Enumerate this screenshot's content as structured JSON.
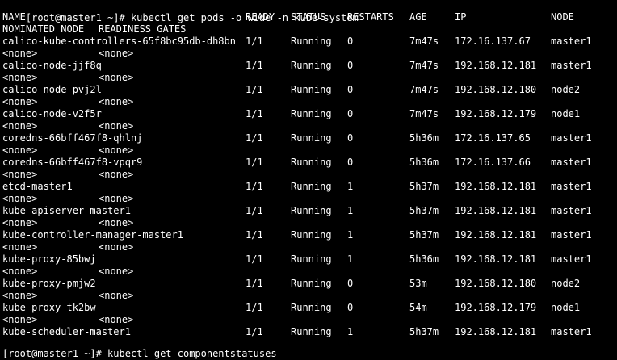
{
  "terminal": {
    "prompt": "[root@master1 ~]# ",
    "command": "kubectl get pods -o wide -n kube-system",
    "headers": {
      "name": "NAME",
      "ready": "READY",
      "status": "STATUS",
      "restarts": "RESTARTS",
      "age": "AGE",
      "ip": "IP",
      "node": "NODE",
      "nominated": "NOMINATED NODE",
      "gates": "READINESS GATES"
    },
    "rows": [
      {
        "name": "calico-kube-controllers-65f8bc95db-dh8bn",
        "ready": "1/1",
        "status": "Running",
        "restarts": "0",
        "age": "7m47s",
        "ip": "172.16.137.67",
        "node": "master1",
        "nominated": "<none>",
        "gates": "<none>"
      },
      {
        "name": "calico-node-jjf8q",
        "ready": "1/1",
        "status": "Running",
        "restarts": "0",
        "age": "7m47s",
        "ip": "192.168.12.181",
        "node": "master1",
        "nominated": "<none>",
        "gates": "<none>"
      },
      {
        "name": "calico-node-pvj2l",
        "ready": "1/1",
        "status": "Running",
        "restarts": "0",
        "age": "7m47s",
        "ip": "192.168.12.180",
        "node": "node2",
        "nominated": "<none>",
        "gates": "<none>"
      },
      {
        "name": "calico-node-v2f5r",
        "ready": "1/1",
        "status": "Running",
        "restarts": "0",
        "age": "7m47s",
        "ip": "192.168.12.179",
        "node": "node1",
        "nominated": "<none>",
        "gates": "<none>"
      },
      {
        "name": "coredns-66bff467f8-qhlnj",
        "ready": "1/1",
        "status": "Running",
        "restarts": "0",
        "age": "5h36m",
        "ip": "172.16.137.65",
        "node": "master1",
        "nominated": "<none>",
        "gates": "<none>"
      },
      {
        "name": "coredns-66bff467f8-vpqr9",
        "ready": "1/1",
        "status": "Running",
        "restarts": "0",
        "age": "5h36m",
        "ip": "172.16.137.66",
        "node": "master1",
        "nominated": "<none>",
        "gates": "<none>"
      },
      {
        "name": "etcd-master1",
        "ready": "1/1",
        "status": "Running",
        "restarts": "1",
        "age": "5h37m",
        "ip": "192.168.12.181",
        "node": "master1",
        "nominated": "<none>",
        "gates": "<none>"
      },
      {
        "name": "kube-apiserver-master1",
        "ready": "1/1",
        "status": "Running",
        "restarts": "1",
        "age": "5h37m",
        "ip": "192.168.12.181",
        "node": "master1",
        "nominated": "<none>",
        "gates": "<none>"
      },
      {
        "name": "kube-controller-manager-master1",
        "ready": "1/1",
        "status": "Running",
        "restarts": "1",
        "age": "5h37m",
        "ip": "192.168.12.181",
        "node": "master1",
        "nominated": "<none>",
        "gates": "<none>"
      },
      {
        "name": "kube-proxy-85bwj",
        "ready": "1/1",
        "status": "Running",
        "restarts": "1",
        "age": "5h36m",
        "ip": "192.168.12.181",
        "node": "master1",
        "nominated": "<none>",
        "gates": "<none>"
      },
      {
        "name": "kube-proxy-pmjw2",
        "ready": "1/1",
        "status": "Running",
        "restarts": "0",
        "age": "53m",
        "ip": "192.168.12.180",
        "node": "node2",
        "nominated": "<none>",
        "gates": "<none>"
      },
      {
        "name": "kube-proxy-tk2bw",
        "ready": "1/1",
        "status": "Running",
        "restarts": "0",
        "age": "54m",
        "ip": "192.168.12.179",
        "node": "node1",
        "nominated": "<none>",
        "gates": "<none>"
      },
      {
        "name": "kube-scheduler-master1",
        "ready": "1/1",
        "status": "Running",
        "restarts": "1",
        "age": "5h37m",
        "ip": "192.168.12.181",
        "node": "master1",
        "nominated": "",
        "gates": ""
      }
    ],
    "next_line": "[root@master1 ~]# kubectl get componentstatuses"
  }
}
